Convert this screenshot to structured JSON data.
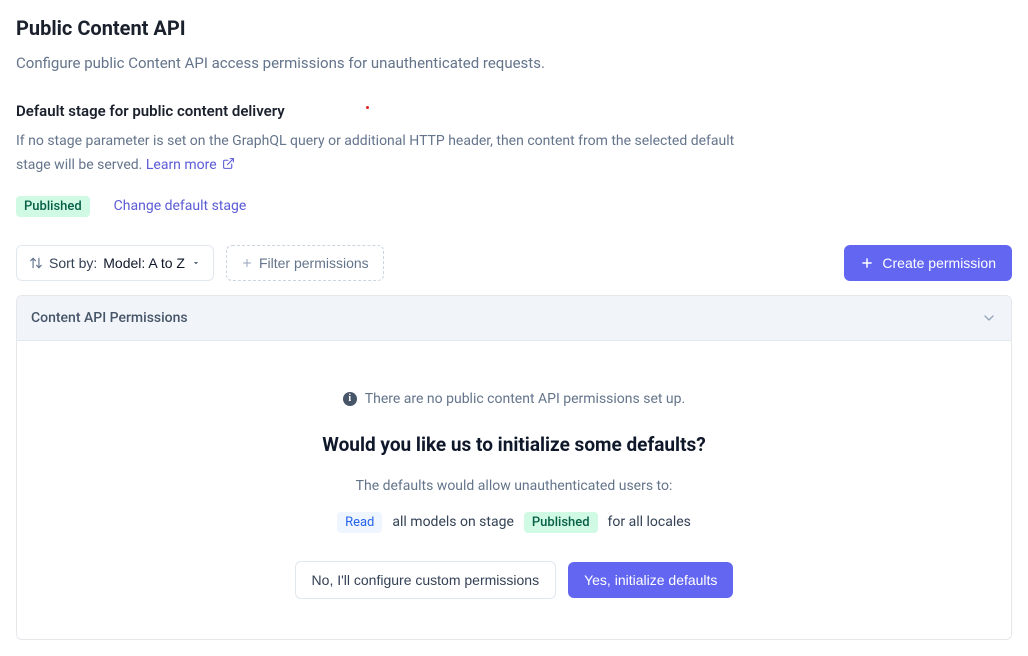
{
  "header": {
    "title": "Public Content API",
    "subtitle": "Configure public Content API access permissions for unauthenticated requests."
  },
  "defaultStage": {
    "heading": "Default stage for public content delivery",
    "description": "If no stage parameter is set on the GraphQL query or additional HTTP header, then content from the selected default stage will be served.",
    "learnMore": "Learn more",
    "badge": "Published",
    "changeLabel": "Change default stage"
  },
  "toolbar": {
    "sortPrefix": "Sort by:",
    "sortValue": "Model: A to Z",
    "filterLabel": "Filter permissions",
    "createLabel": "Create permission"
  },
  "panel": {
    "headerLabel": "Content API Permissions"
  },
  "empty": {
    "line": "There are no public content API permissions set up.",
    "heading": "Would you like us to initialize some defaults?",
    "desc": "The defaults would allow unauthenticated users to:",
    "readBadge": "Read",
    "text1": "all models on stage",
    "publishedBadge": "Published",
    "text2": "for all locales",
    "noLabel": "No, I'll configure custom permissions",
    "yesLabel": "Yes, initialize defaults"
  }
}
